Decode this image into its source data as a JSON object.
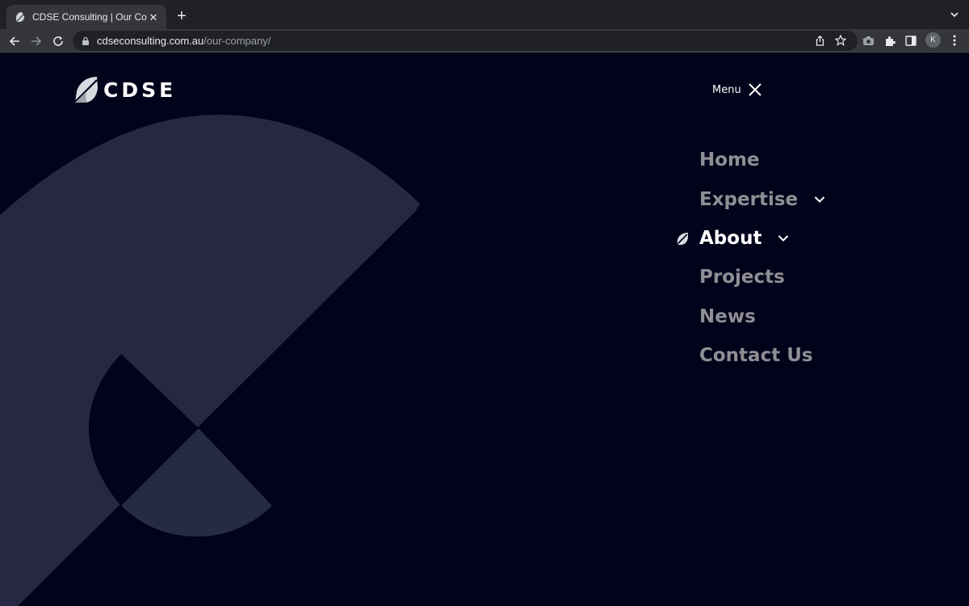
{
  "browser": {
    "tab_title": "CDSE Consulting | Our Company",
    "url_host": "cdseconsulting.com.au",
    "url_path": "/our-company/",
    "profile_initial": "K"
  },
  "site": {
    "logo_text": "CDSE",
    "menu_label": "Menu",
    "nav": [
      {
        "label": "Home",
        "has_children": false,
        "active": false
      },
      {
        "label": "Expertise",
        "has_children": true,
        "active": false
      },
      {
        "label": "About",
        "has_children": true,
        "active": true
      },
      {
        "label": "Projects",
        "has_children": false,
        "active": false
      },
      {
        "label": "News",
        "has_children": false,
        "active": false
      },
      {
        "label": "Contact Us",
        "has_children": false,
        "active": false
      }
    ]
  },
  "colors": {
    "page_background": "#02021a",
    "shape_main": "#262742",
    "shape_accent": "#252a45",
    "nav_inactive": "#8e8e95",
    "nav_active": "#ffffff"
  }
}
